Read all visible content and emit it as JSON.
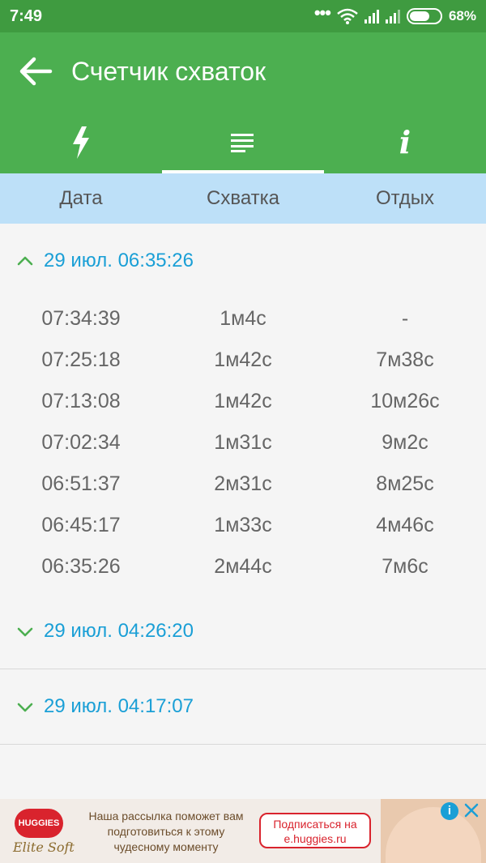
{
  "status_bar": {
    "time": "7:49",
    "battery": "68%",
    "battery_level": 0.68
  },
  "app_bar": {
    "title": "Счетчик схваток",
    "tabs": [
      {
        "icon": "lightning-icon",
        "active": false
      },
      {
        "icon": "list-icon",
        "active": true
      },
      {
        "icon": "info-icon",
        "active": false
      }
    ]
  },
  "table_header": {
    "columns": [
      "Дата",
      "Схватка",
      "Отдых"
    ]
  },
  "sessions": [
    {
      "date": "29 июл. 06:35:26",
      "expanded": true,
      "rows": [
        {
          "time": "07:34:39",
          "contraction": "1м4с",
          "rest": "-"
        },
        {
          "time": "07:25:18",
          "contraction": "1м42с",
          "rest": "7м38с"
        },
        {
          "time": "07:13:08",
          "contraction": "1м42с",
          "rest": "10м26с"
        },
        {
          "time": "07:02:34",
          "contraction": "1м31с",
          "rest": "9м2с"
        },
        {
          "time": "06:51:37",
          "contraction": "2м31с",
          "rest": "8м25с"
        },
        {
          "time": "06:45:17",
          "contraction": "1м33с",
          "rest": "4м46с"
        },
        {
          "time": "06:35:26",
          "contraction": "2м44с",
          "rest": "7м6с"
        }
      ]
    },
    {
      "date": "29 июл. 04:26:20",
      "expanded": false,
      "rows": []
    },
    {
      "date": "29 июл. 04:17:07",
      "expanded": false,
      "rows": []
    }
  ],
  "ad": {
    "brand": "HUGGIES",
    "brand_line": "Elite Soft",
    "text": "Наша рассылка поможет вам подготовиться к этому чудесному моменту",
    "cta": "Подписаться на e.huggies.ru"
  },
  "colors": {
    "status_bar": "#3f9b40",
    "app_bar": "#4caf50",
    "header_bg": "#bde0f8",
    "date_blue": "#1a9fd6"
  }
}
